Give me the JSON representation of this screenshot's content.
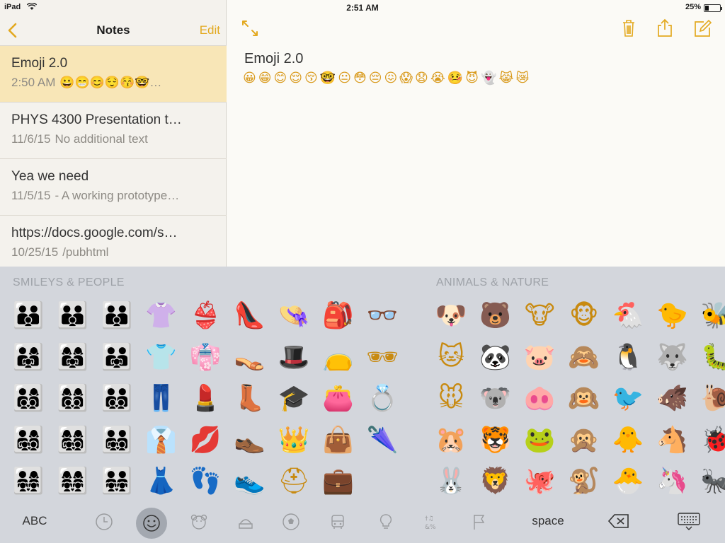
{
  "status_bar": {
    "carrier": "iPad",
    "time": "2:51 AM",
    "battery_text": "25%",
    "battery_level": 0.25
  },
  "sidebar": {
    "title": "Notes",
    "edit_label": "Edit",
    "notes": [
      {
        "title": "Emoji 2.0",
        "date": "2:50 AM",
        "preview": "😀😁😊😌😚🤓…",
        "selected": true
      },
      {
        "title": "PHYS 4300 Presentation t…",
        "date": "11/6/15",
        "preview": "No additional text",
        "selected": false
      },
      {
        "title": "Yea we need",
        "date": "11/5/15",
        "preview": "- A working prototype…",
        "selected": false
      },
      {
        "title": "https://docs.google.com/s…",
        "date": "10/25/15",
        "preview": "/pubhtml",
        "selected": false
      }
    ]
  },
  "main": {
    "toolbar_icons": [
      "expand-icon",
      "trash-icon",
      "share-icon",
      "compose-icon"
    ],
    "note_title": "Emoji 2.0",
    "note_emoji": "😀😁😊😌😚🤓😐😳😔😖😱😧😭🤒😈👻😹😿"
  },
  "keyboard": {
    "smileys_heading": "SMILEYS & PEOPLE",
    "animals_heading": "ANIMALS & NATURE",
    "smileys_emoji": [
      "👪",
      "👪",
      "👨‍👨‍👦",
      "👚",
      "👙",
      "👠",
      "👒",
      "🎒",
      "👓",
      "👨‍👩‍👧",
      "👩‍👩‍👧",
      "👨‍👨‍👧",
      "👕",
      "👘",
      "👡",
      "🎩",
      "👝",
      "🕶",
      "👨‍👩‍👦‍👦",
      "👩‍👩‍👦‍👦",
      "👨‍👨‍👦‍👦",
      "👖",
      "💄",
      "👢",
      "🎓",
      "👛",
      "💍",
      "👨‍👩‍👧‍👦",
      "👩‍👩‍👧‍👦",
      "👨‍👨‍👧‍👦",
      "👔",
      "💋",
      "👞",
      "👑",
      "👜",
      "🌂",
      "👨‍👩‍👧‍👧",
      "👩‍👩‍👧‍👧",
      "👨‍👨‍👧‍👧",
      "👗",
      "👣",
      "👟",
      "⛑",
      "💼",
      ""
    ],
    "animals_emoji": [
      "🐶",
      "🐻",
      "🐮",
      "🐵",
      "🐔",
      "🐤",
      "🐝",
      "🐱",
      "🐼",
      "🐷",
      "🙈",
      "🐧",
      "🐺",
      "🐛",
      "🐭",
      "🐨",
      "🐽",
      "🙉",
      "🐦",
      "🐗",
      "🐌",
      "🐹",
      "🐯",
      "🐸",
      "🙊",
      "🐥",
      "🐴",
      "🐞",
      "🐰",
      "🦁",
      "🐙",
      "🐒",
      "🐣",
      "🦄",
      "🐜"
    ],
    "abc_label": "ABC",
    "space_label": "space",
    "categories": [
      "clock-icon",
      "smiley-icon",
      "bear-icon",
      "food-icon",
      "ball-icon",
      "car-icon",
      "bulb-icon",
      "symbols-icon",
      "flag-icon"
    ],
    "active_category": "smiley-icon"
  }
}
